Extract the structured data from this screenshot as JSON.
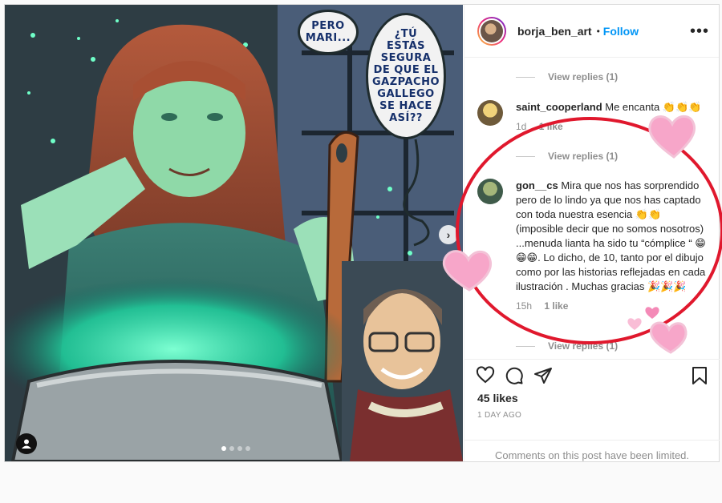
{
  "post": {
    "author": "borja_ben_art",
    "bullet": "•",
    "follow_label": "Follow",
    "more_label": "•••",
    "likes": "45 likes",
    "time_ago": "1 DAY AGO",
    "comments_limited": "Comments on this post have been limited."
  },
  "media": {
    "bubbles": [
      "PERO\nMARI...",
      "¿TÚ\nESTÁS\nSEGURA\nDE QUE EL\nGAZPACHO\nGALLEGO\nSE HACE\nASÍ??"
    ],
    "next_icon": "›",
    "page_dots": 4,
    "active_dot": 0,
    "icons": [
      "chevron-right-icon",
      "user-tag-icon"
    ]
  },
  "comments": {
    "view_replies_1": "View replies (1)",
    "view_replies_2": "View replies (1)",
    "view_replies_3": "View replies (1)",
    "items": [
      {
        "user": "saint_cooperland",
        "text": "Me encanta 👏👏👏",
        "time": "1d",
        "likes": "1 like"
      },
      {
        "user": "gon__cs",
        "text": "Mira que nos has sorprendido pero de lo lindo ya que nos has captado con toda nuestra esencia 👏👏 (imposible decir que no somos nosotros) ...menuda lianta ha sido tu “cómplice “ 😁😁😁. Lo dicho, de 10, tanto por el dibujo como por las historias reflejadas en cada ilustración . Muchas gracias 🎉🎉🎉",
        "time": "15h",
        "likes": "1 like"
      }
    ]
  },
  "action_icons": [
    "heart-icon",
    "comment-icon",
    "share-icon",
    "bookmark-icon"
  ],
  "colors": {
    "accent": "#0095f6",
    "annotation_circle": "#e0182d",
    "heart_pink": "#f7a6c9"
  }
}
